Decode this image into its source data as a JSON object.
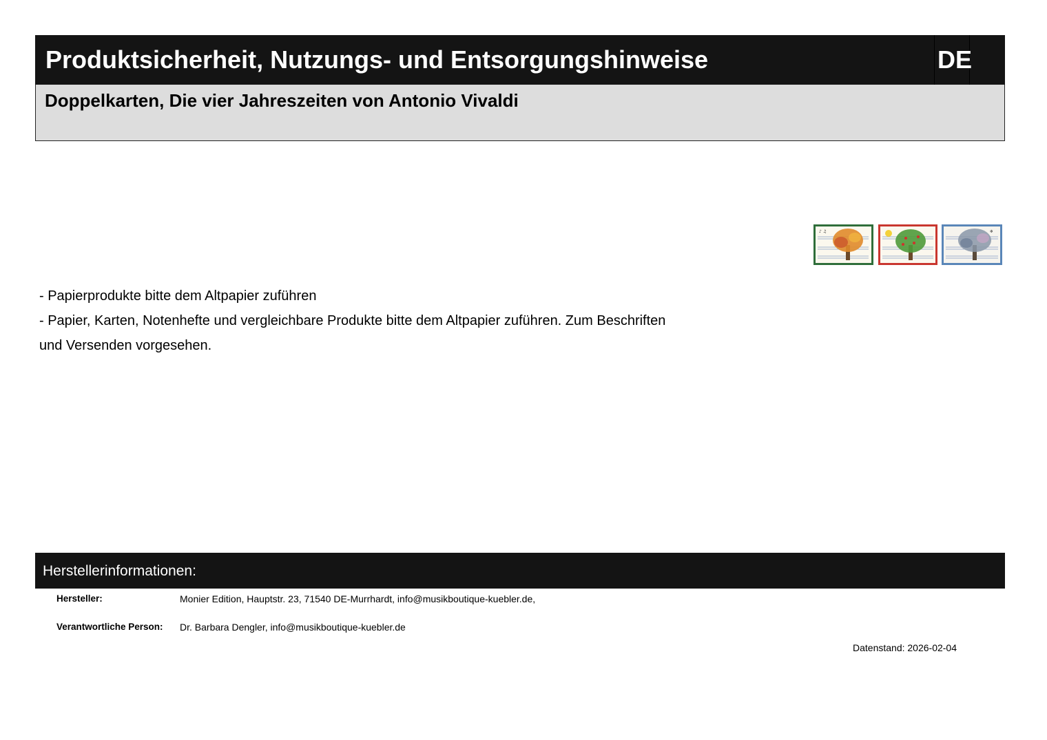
{
  "header": {
    "title": "Produktsicherheit, Nutzungs- und Entsorgungshinweise",
    "language": "DE"
  },
  "product": {
    "name": "Doppelkarten, Die vier Jahreszeiten von Antonio Vivaldi"
  },
  "thumbnails": [
    {
      "name": "Herbst-Karte",
      "frame_color": "#2f6e3a",
      "tree_color": "#e08a2a"
    },
    {
      "name": "Sommer-Karte",
      "frame_color": "#c9362f",
      "tree_color": "#4f9a3a"
    },
    {
      "name": "Winter-Karte",
      "frame_color": "#5a86b8",
      "tree_color": "#8a96a8"
    }
  ],
  "notes": [
    "- Papierprodukte bitte dem Altpapier zuführen",
    "- Papier, Karten, Notenhefte und vergleichbare Produkte bitte dem Altpapier zuführen. Zum Beschriften",
    "und Versenden vorgesehen."
  ],
  "manufacturer_section": {
    "title": "Herstellerinformationen:",
    "manufacturer_label": "Hersteller:",
    "manufacturer_value": "Monier Edition, Hauptstr. 23, 71540 DE-Murrhardt, info@musikboutique-kuebler.de,",
    "responsible_label": "Verantwortliche Person:",
    "responsible_value": "Dr. Barbara Dengler, info@musikboutique-kuebler.de"
  },
  "date_line": "Datenstand: 2026-02-04"
}
